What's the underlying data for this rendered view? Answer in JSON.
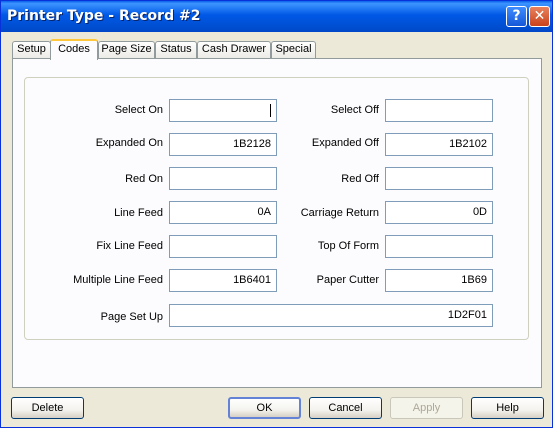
{
  "window": {
    "title": "Printer Type - Record #2"
  },
  "titlebar_buttons": {
    "help": "?",
    "close": "✕"
  },
  "tabs": [
    {
      "label": "Setup"
    },
    {
      "label": "Codes"
    },
    {
      "label": "Page Size"
    },
    {
      "label": "Status"
    },
    {
      "label": "Cash Drawer"
    },
    {
      "label": "Special"
    }
  ],
  "active_tab": "Codes",
  "fields": {
    "select_on": {
      "label": "Select On",
      "value": ""
    },
    "select_off": {
      "label": "Select Off",
      "value": ""
    },
    "expanded_on": {
      "label": "Expanded On",
      "value": "1B2128"
    },
    "expanded_off": {
      "label": "Expanded Off",
      "value": "1B2102"
    },
    "red_on": {
      "label": "Red On",
      "value": ""
    },
    "red_off": {
      "label": "Red Off",
      "value": ""
    },
    "line_feed": {
      "label": "Line Feed",
      "value": "0A"
    },
    "carriage_return": {
      "label": "Carriage Return",
      "value": "0D"
    },
    "fix_line_feed": {
      "label": "Fix Line Feed",
      "value": ""
    },
    "top_of_form": {
      "label": "Top Of Form",
      "value": ""
    },
    "multiple_line_feed": {
      "label": "Multiple Line Feed",
      "value": "1B6401"
    },
    "paper_cutter": {
      "label": "Paper Cutter",
      "value": "1B69"
    },
    "page_set_up": {
      "label": "Page Set Up",
      "value": "1D2F01"
    }
  },
  "buttons": {
    "delete": "Delete",
    "ok": "OK",
    "cancel": "Cancel",
    "apply": "Apply",
    "help": "Help"
  },
  "colors": {
    "titlebar": "#0058E6",
    "window_bg": "#ECE9D8",
    "tab_highlight": "#FFC83C",
    "field_border": "#7F9DB9"
  }
}
